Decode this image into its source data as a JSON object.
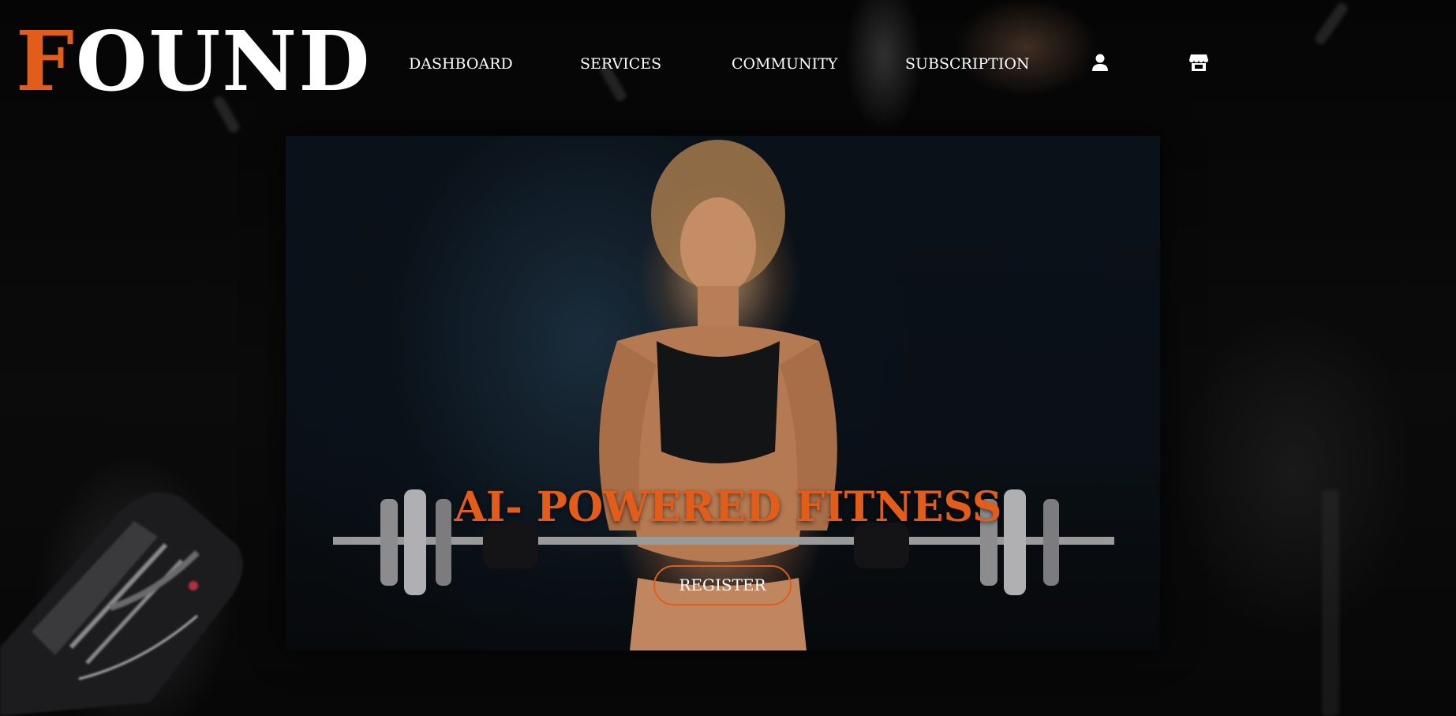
{
  "brand": {
    "logo_first_letter": "F",
    "logo_rest": "OUND",
    "accent_color": "#e25d1a"
  },
  "nav": {
    "items": [
      {
        "label": "DASHBOARD"
      },
      {
        "label": "SERVICES"
      },
      {
        "label": "COMMUNITY"
      },
      {
        "label": "SUBSCRIPTION"
      }
    ],
    "icons": [
      "user-icon",
      "store-icon"
    ]
  },
  "hero": {
    "title": "AI- POWERED FITNESS",
    "cta_label": "REGISTER",
    "image": "woman-lifting-dumbbell-barbell"
  }
}
